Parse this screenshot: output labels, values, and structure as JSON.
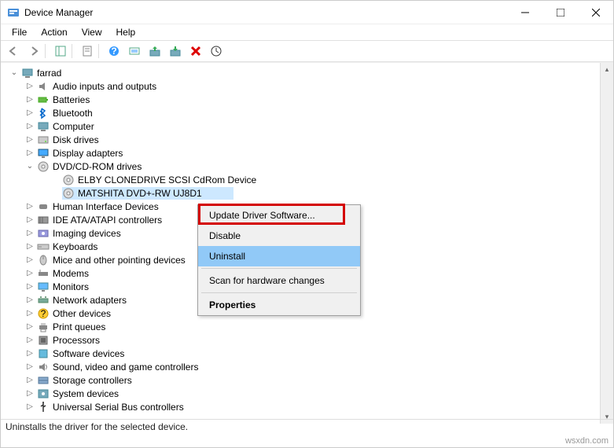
{
  "window": {
    "title": "Device Manager"
  },
  "menus": {
    "file": "File",
    "action": "Action",
    "view": "View",
    "help": "Help"
  },
  "root": "farrad",
  "nodes": [
    {
      "label": "Audio inputs and outputs",
      "exp": "▷",
      "icon": "audio"
    },
    {
      "label": "Batteries",
      "exp": "▷",
      "icon": "battery"
    },
    {
      "label": "Bluetooth",
      "exp": "▷",
      "icon": "bluetooth"
    },
    {
      "label": "Computer",
      "exp": "▷",
      "icon": "computer"
    },
    {
      "label": "Disk drives",
      "exp": "▷",
      "icon": "disk"
    },
    {
      "label": "Display adapters",
      "exp": "▷",
      "icon": "display"
    },
    {
      "label": "DVD/CD-ROM drives",
      "exp": "⌄",
      "icon": "dvd",
      "children": [
        {
          "label": "ELBY CLONEDRIVE SCSI CdRom Device",
          "icon": "dvd-dev"
        },
        {
          "label": "MATSHITA DVD+-RW UJ8D1",
          "icon": "dvd-dev",
          "selected": true
        }
      ]
    },
    {
      "label": "Human Interface Devices",
      "exp": "▷",
      "icon": "hid"
    },
    {
      "label": "IDE ATA/ATAPI controllers",
      "exp": "▷",
      "icon": "ide"
    },
    {
      "label": "Imaging devices",
      "exp": "▷",
      "icon": "imaging"
    },
    {
      "label": "Keyboards",
      "exp": "▷",
      "icon": "keyboard"
    },
    {
      "label": "Mice and other pointing devices",
      "exp": "▷",
      "icon": "mouse"
    },
    {
      "label": "Modems",
      "exp": "▷",
      "icon": "modem"
    },
    {
      "label": "Monitors",
      "exp": "▷",
      "icon": "monitor"
    },
    {
      "label": "Network adapters",
      "exp": "▷",
      "icon": "network"
    },
    {
      "label": "Other devices",
      "exp": "▷",
      "icon": "other"
    },
    {
      "label": "Print queues",
      "exp": "▷",
      "icon": "print"
    },
    {
      "label": "Processors",
      "exp": "▷",
      "icon": "cpu"
    },
    {
      "label": "Software devices",
      "exp": "▷",
      "icon": "software"
    },
    {
      "label": "Sound, video and game controllers",
      "exp": "▷",
      "icon": "sound"
    },
    {
      "label": "Storage controllers",
      "exp": "▷",
      "icon": "storage"
    },
    {
      "label": "System devices",
      "exp": "▷",
      "icon": "system"
    },
    {
      "label": "Universal Serial Bus controllers",
      "exp": "▷",
      "icon": "usb"
    }
  ],
  "context": {
    "update": "Update Driver Software...",
    "disable": "Disable",
    "uninstall": "Uninstall",
    "scan": "Scan for hardware changes",
    "properties": "Properties"
  },
  "status": "Uninstalls the driver for the selected device.",
  "watermark": "wsxdn.com"
}
